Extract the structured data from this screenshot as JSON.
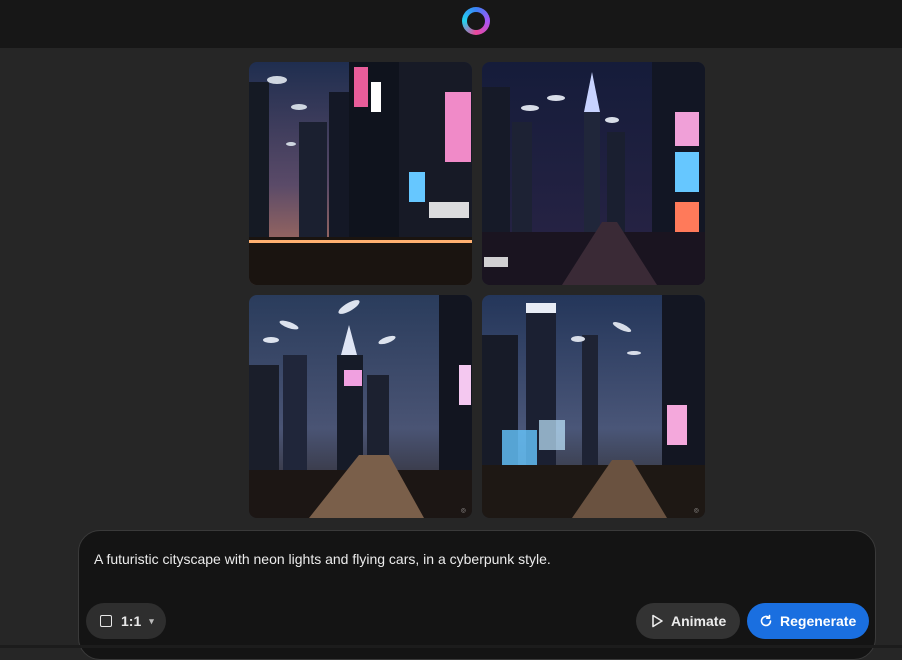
{
  "header": {
    "logo_icon": "copilot-ring-icon"
  },
  "images": [
    {
      "name": "generated-image-1",
      "alt": ""
    },
    {
      "name": "generated-image-2",
      "alt": ""
    },
    {
      "name": "generated-image-3",
      "alt": ""
    },
    {
      "name": "generated-image-4",
      "alt": ""
    }
  ],
  "composer": {
    "prompt": "A futuristic cityscape with neon lights and flying cars, in a cyberpunk style.",
    "aspect_ratio": "1:1",
    "animate_label": "Animate",
    "regenerate_label": "Regenerate"
  },
  "colors": {
    "accent": "#1a6fe0",
    "background": "#262626",
    "topbar": "#171717"
  }
}
